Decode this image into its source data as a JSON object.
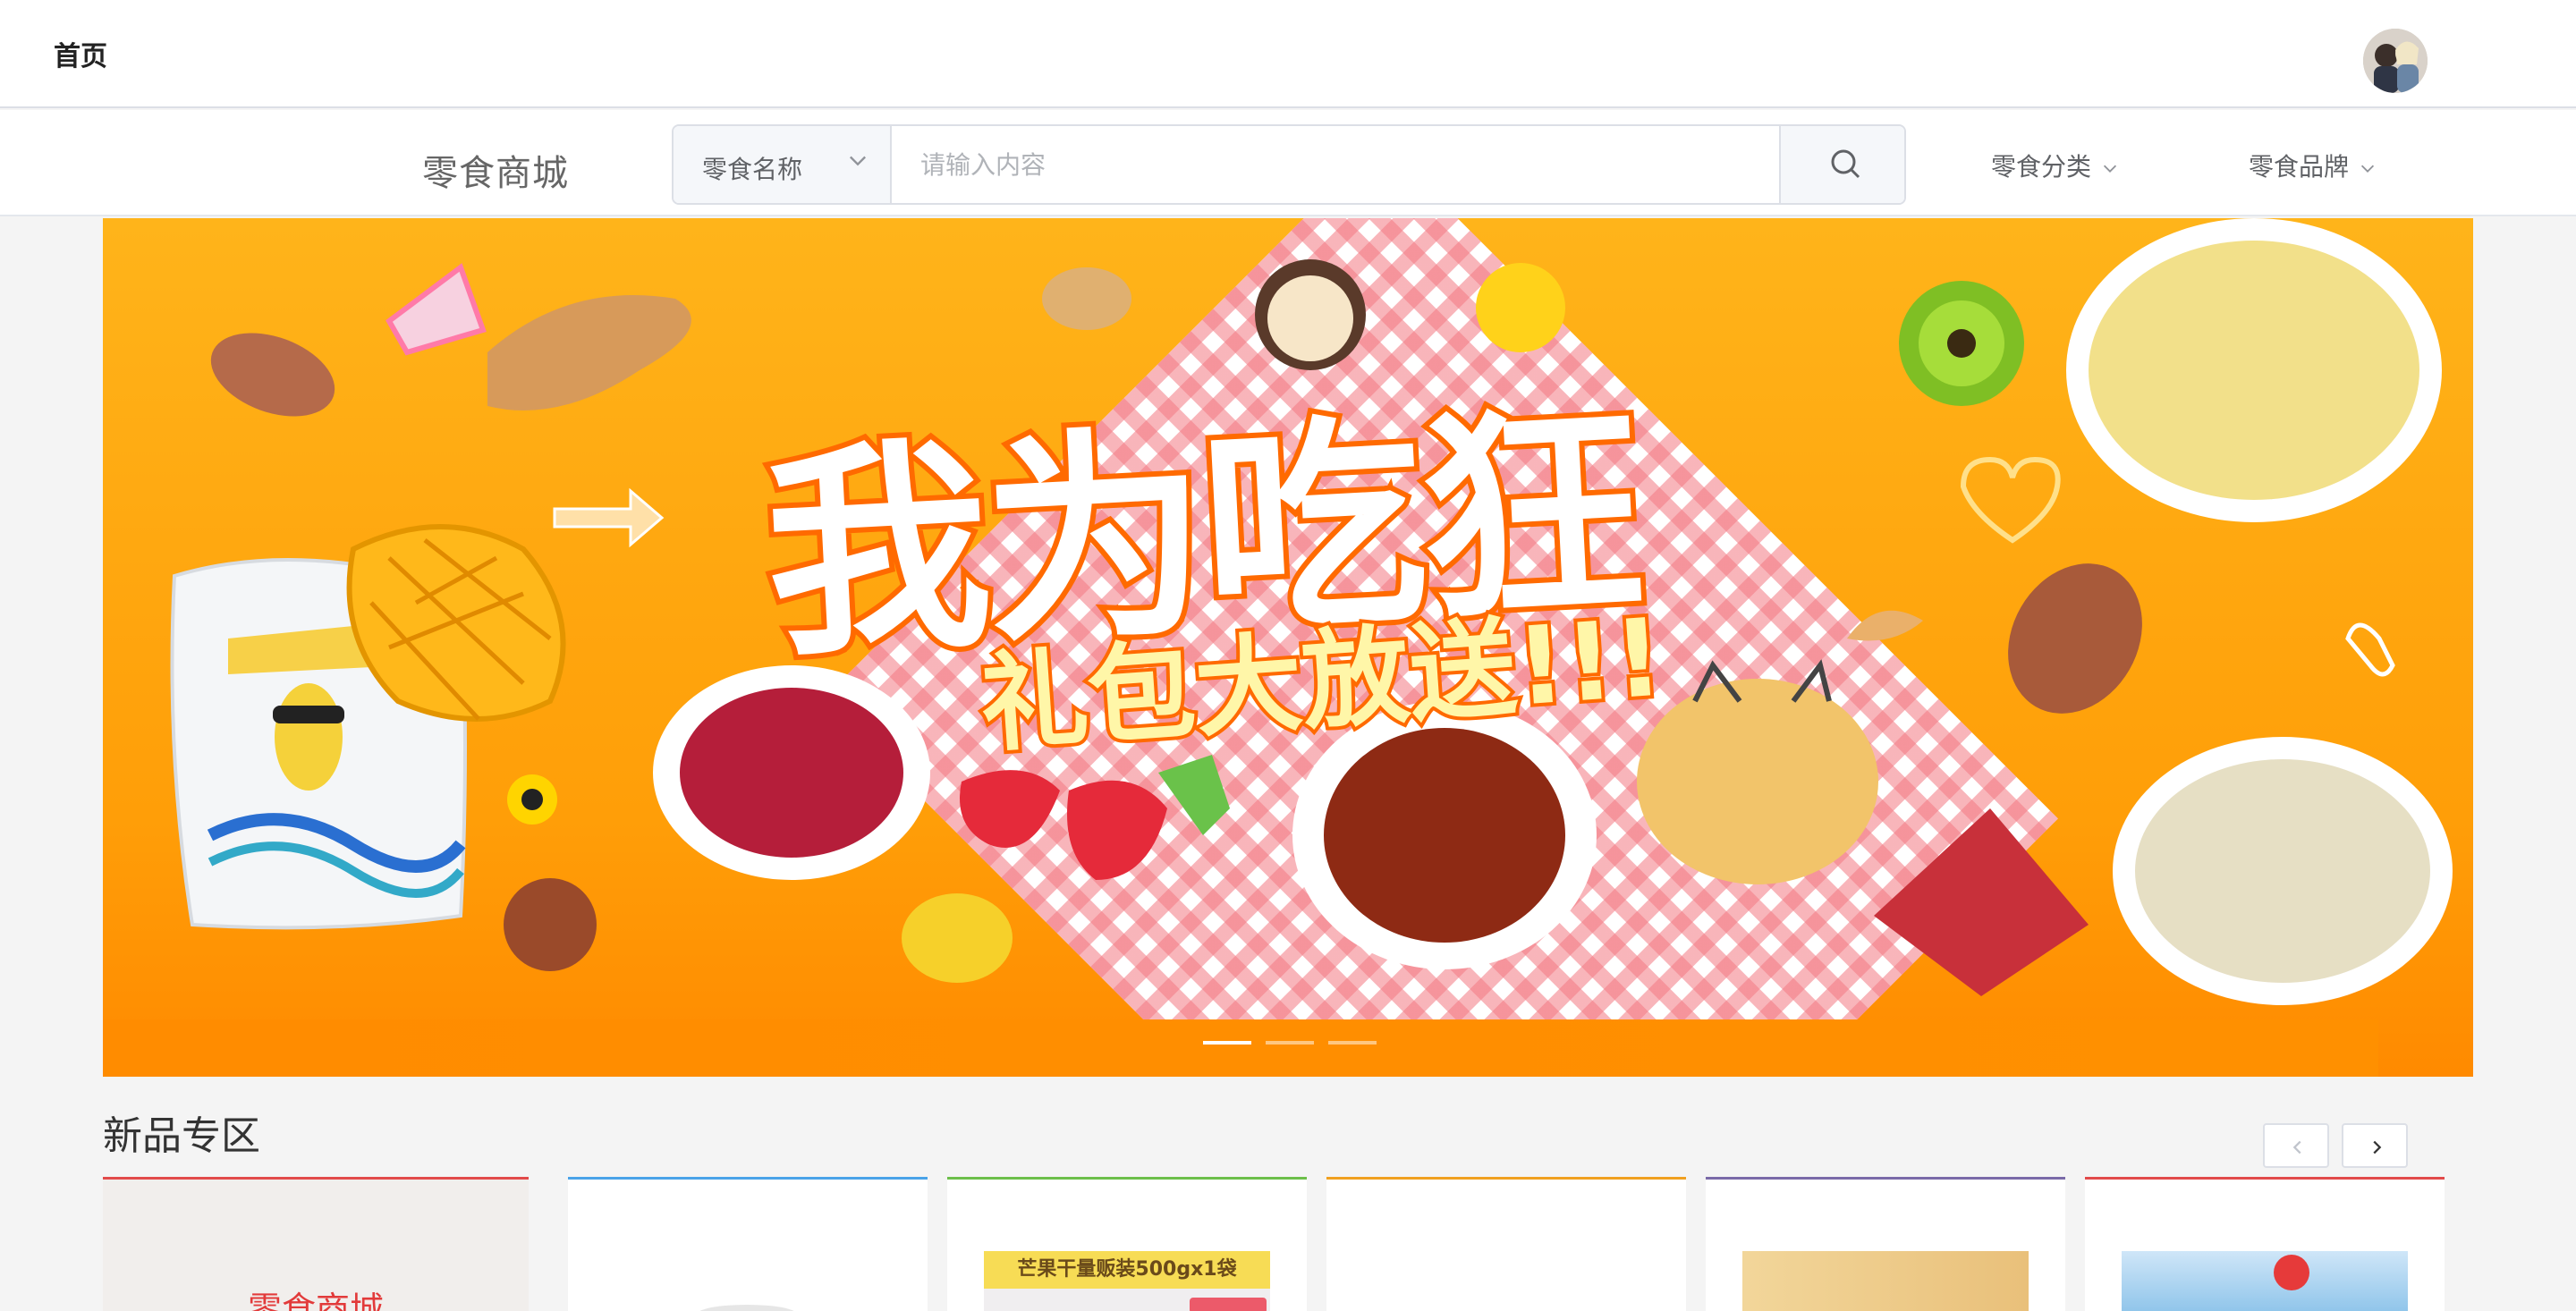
{
  "topbar": {
    "home_label": "首页"
  },
  "brand": {
    "name": "零食商城"
  },
  "search": {
    "select_label": "零食名称",
    "placeholder": "请输入内容"
  },
  "nav": {
    "category_label": "零食分类",
    "brand_label": "零食品牌"
  },
  "banner": {
    "headline": "我为吃狂",
    "subline": "礼包大放送!!!",
    "product_bag_label": "芒果干",
    "active_slide": 1,
    "slide_count": 3
  },
  "section": {
    "title": "新品专区"
  },
  "cards": [
    {
      "title": "零食商城",
      "accent": "#e24a4a"
    },
    {
      "title": "",
      "accent": "#4aa3e8"
    },
    {
      "title": "芒果干量贩装500gx1袋",
      "accent": "#6cbf4a"
    },
    {
      "title": "",
      "accent": "#f0a020"
    },
    {
      "title": "",
      "accent": "#7a6aa8"
    },
    {
      "title": "",
      "accent": "#e24a4a"
    }
  ],
  "colors": {
    "brand_text": "#666666",
    "banner_orange": "#ff9e08",
    "accent_red": "#e23a3a"
  }
}
